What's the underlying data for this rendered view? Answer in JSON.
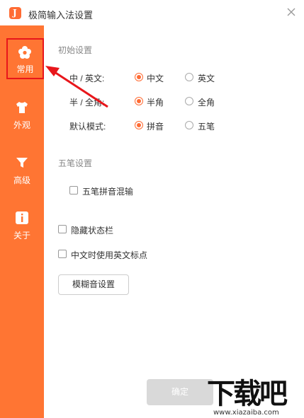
{
  "window": {
    "title": "极简输入法设置",
    "logo_letter": "J"
  },
  "sidebar": {
    "items": [
      {
        "label": "常用",
        "icon": "flower-icon",
        "active": true
      },
      {
        "label": "外观",
        "icon": "shirt-icon",
        "active": false
      },
      {
        "label": "高级",
        "icon": "funnel-icon",
        "active": false
      },
      {
        "label": "关于",
        "icon": "info-icon",
        "active": false
      }
    ]
  },
  "initial_settings": {
    "title": "初始设置",
    "rows": [
      {
        "label": "中 / 英文:",
        "options": [
          "中文",
          "英文"
        ],
        "selected": "中文"
      },
      {
        "label": "半 / 全角:",
        "options": [
          "半角",
          "全角"
        ],
        "selected": "半角"
      },
      {
        "label": "默认模式:",
        "options": [
          "拼音",
          "五笔"
        ],
        "selected": "拼音"
      }
    ]
  },
  "wubi_settings": {
    "title": "五笔设置",
    "mixed_input_label": "五笔拼音混输",
    "mixed_input_checked": false
  },
  "hide_statusbar": {
    "label": "隐藏状态栏",
    "checked": false
  },
  "english_punct": {
    "label": "中文时使用英文标点",
    "checked": false
  },
  "fuzzy_button": "模糊音设置",
  "ok_button": "确定",
  "watermark": {
    "text": "下载吧",
    "url": "www.xiazaiba.com"
  },
  "colors": {
    "accent": "#ff7533",
    "highlight_box": "#e8161b",
    "disabled": "#d9d9d9"
  }
}
